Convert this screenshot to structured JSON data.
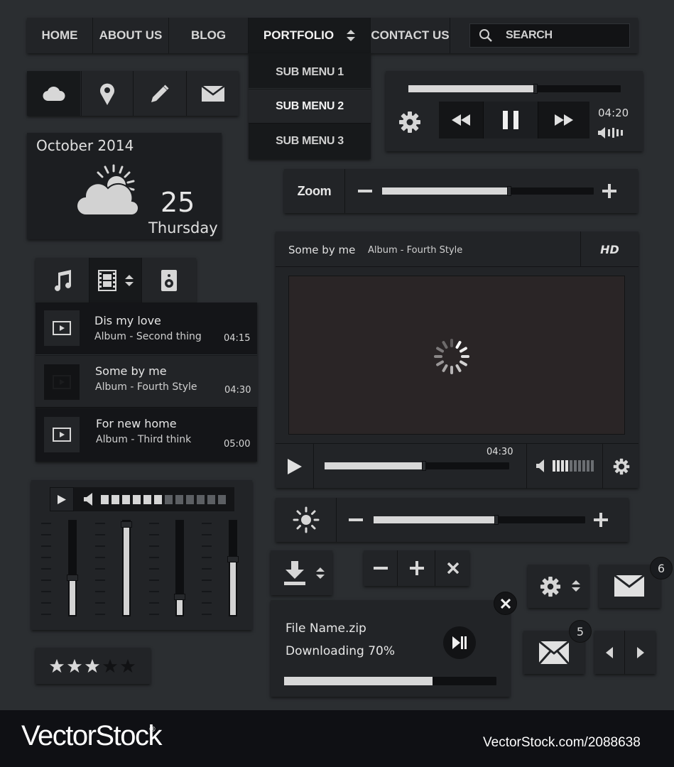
{
  "nav": {
    "items": [
      "HOME",
      "ABOUT US",
      "BLOG",
      "PORTFOLIO",
      "CONTACT US"
    ],
    "search_placeholder": "SEARCH",
    "submenu": [
      "SUB MENU 1",
      "SUB MENU 2",
      "SUB MENU 3"
    ]
  },
  "icon_bar": [
    "cloud-icon",
    "location-pin-icon",
    "pencil-icon",
    "envelope-icon"
  ],
  "weather": {
    "month": "October 2014",
    "day_num": "25",
    "weekday": "Thursday",
    "icon": "sun-cloud-icon"
  },
  "audio_player": {
    "time": "04:20",
    "progress": 0.6
  },
  "zoom": {
    "label": "Zoom",
    "level": 0.6
  },
  "media_tabs": [
    "music-note-icon",
    "film-icon",
    "speaker-icon"
  ],
  "playlist": [
    {
      "title": "Dis my love",
      "album": "Album - Second thing",
      "duration": "04:15"
    },
    {
      "title": "Some by me",
      "album": "Album - Fourth Style",
      "duration": "04:30"
    },
    {
      "title": "For new home",
      "album": "Album - Third think",
      "duration": "05:00"
    }
  ],
  "video": {
    "title": "Some by me",
    "album": "Album - Fourth Style",
    "quality": "HD",
    "time": "04:30",
    "progress": 0.54,
    "volume_bars": 10,
    "volume_active": 4
  },
  "brightness": {
    "level": 0.58
  },
  "mixer": {
    "volume_segments": 12,
    "volume_active": 6,
    "faders": [
      0.4,
      0.97,
      0.2,
      0.6
    ]
  },
  "rating": {
    "value": 3,
    "max": 5
  },
  "download": {
    "file_name": "File Name.zip",
    "status": "Downloading 70%",
    "progress": 0.7
  },
  "badges": {
    "mail_top": "6",
    "mail_bottom": "5"
  },
  "watermark": {
    "brand": "VectorStock",
    "id": "VectorStock.com/2088638"
  },
  "colors": {
    "background": "#2b2e31",
    "panel": "#1f2124",
    "fill": "#d8d8d8",
    "footer": "#0f1014"
  }
}
